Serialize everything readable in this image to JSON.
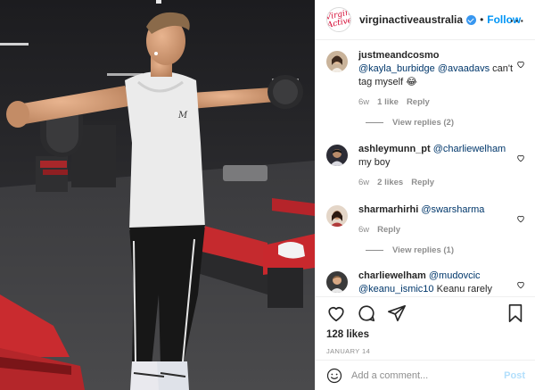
{
  "post": {
    "account": "virginactiveaustralia",
    "logo_text": "Virgin Active",
    "follow_separator": "•",
    "follow_label": "Follow",
    "more_label": "···"
  },
  "comments": [
    {
      "author": "justmeandcosmo",
      "mentions": [
        "@kayla_burbidge",
        "@avaadavs"
      ],
      "text": "can't tag myself 😂",
      "age": "6w",
      "likes": "1 like",
      "reply_label": "Reply",
      "view_replies": "View replies (2)"
    },
    {
      "author": "ashleymunn_pt",
      "mentions": [
        "@charliewelham"
      ],
      "text": "my boy",
      "age": "6w",
      "likes": "2 likes",
      "reply_label": "Reply"
    },
    {
      "author": "sharmarhirhi",
      "mentions": [
        "@swarsharma"
      ],
      "age": "6w",
      "reply_label": "Reply",
      "view_replies": "View replies (1)"
    },
    {
      "author": "charliewelham",
      "mentions": [
        "@mudovcic",
        "@keanu_ismic10"
      ],
      "text": "Keanu rarely"
    }
  ],
  "actions": {
    "likes": "128 likes",
    "date": "JANUARY 14"
  },
  "composer": {
    "placeholder": "Add a comment...",
    "post_label": "Post"
  },
  "colors": {
    "accent": "#0095f6",
    "mention": "#00376b",
    "muted": "#8e8e8e",
    "brand_red": "#d3032e"
  }
}
